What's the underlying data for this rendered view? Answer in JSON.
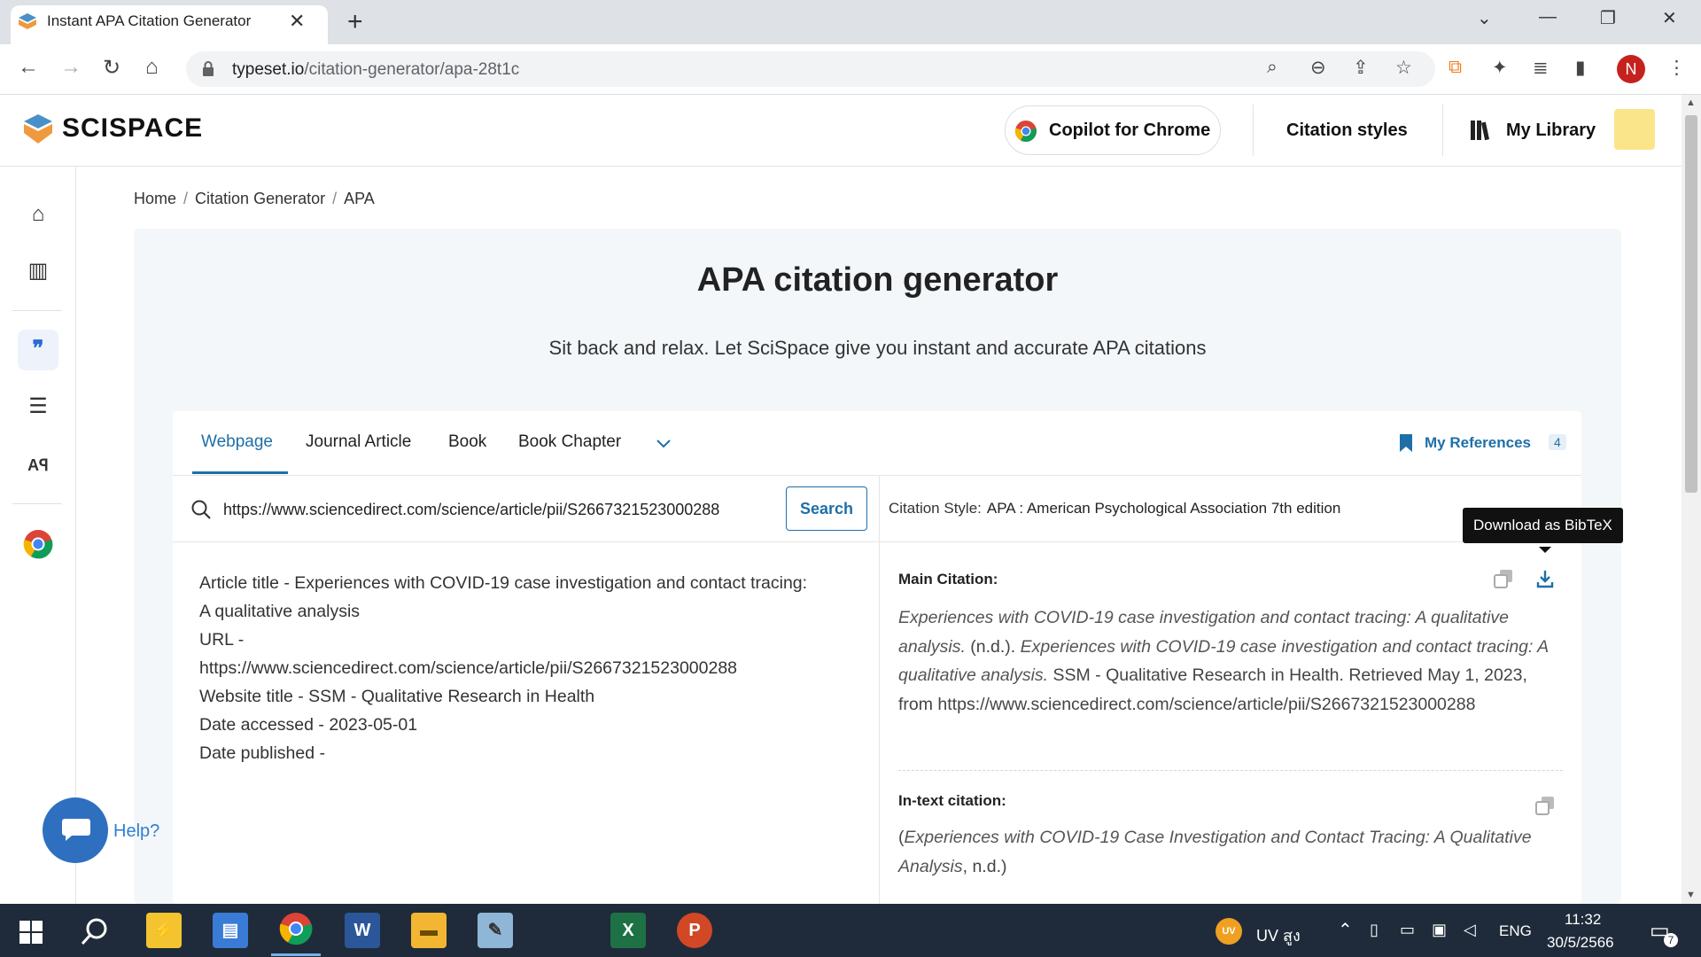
{
  "browser": {
    "tab_title": "Instant APA Citation Generator",
    "url_domain": "typeset.io",
    "url_path": "/citation-generator/apa-28t1c",
    "profile_initial": "N"
  },
  "header": {
    "logo": "SCISPACE",
    "copilot": "Copilot for Chrome",
    "citation_styles": "Citation styles",
    "my_library": "My Library"
  },
  "breadcrumb": {
    "home": "Home",
    "generator": "Citation Generator",
    "current": "APA"
  },
  "hero": {
    "title": "APA citation generator",
    "subtitle": "Sit back and relax. Let SciSpace give you instant and accurate APA citations"
  },
  "source_tabs": {
    "webpage": "Webpage",
    "journal": "Journal Article",
    "book": "Book",
    "chapter": "Book Chapter"
  },
  "my_references": {
    "label": "My References",
    "count": "4"
  },
  "search": {
    "value": "https://www.sciencedirect.com/science/article/pii/S2667321523000288",
    "button": "Search"
  },
  "citation_style": {
    "label": "Citation Style:",
    "value": "APA : American Psychological Association 7th edition"
  },
  "tooltip": "Download as BibTeX",
  "info": {
    "line1": "Article title - Experiences with COVID-19 case investigation and contact tracing: A qualitative analysis",
    "line2": "URL -",
    "line3": "https://www.sciencedirect.com/science/article/pii/S2667321523000288",
    "line4": "Website title - SSM - Qualitative Research in Health",
    "line5": "Date accessed - 2023-05-01",
    "line6": "Date published -"
  },
  "main_citation": {
    "label": "Main Citation:",
    "title_italic": "Experiences with COVID-19 case investigation and contact tracing: A qualitative analysis.",
    "nd": " (n.d.). ",
    "title_italic2": "Experiences with COVID-19 case investigation and contact tracing: A qualitative analysis.",
    "rest": " SSM - Qualitative Research in Health. Retrieved May 1, 2023, from https://www.sciencedirect.com/science/article/pii/S2667321523000288"
  },
  "intext_citation": {
    "label": "In-text citation:",
    "open": "(",
    "italic": "Experiences with COVID-19 Case Investigation and Contact Tracing: A Qualitative Analysis",
    "close": ", n.d.)"
  },
  "help_label": "Help?",
  "taskbar": {
    "uv_label": "UV สูง",
    "lang": "ENG",
    "time": "11:32",
    "date": "30/5/2566",
    "notif_count": "7"
  }
}
